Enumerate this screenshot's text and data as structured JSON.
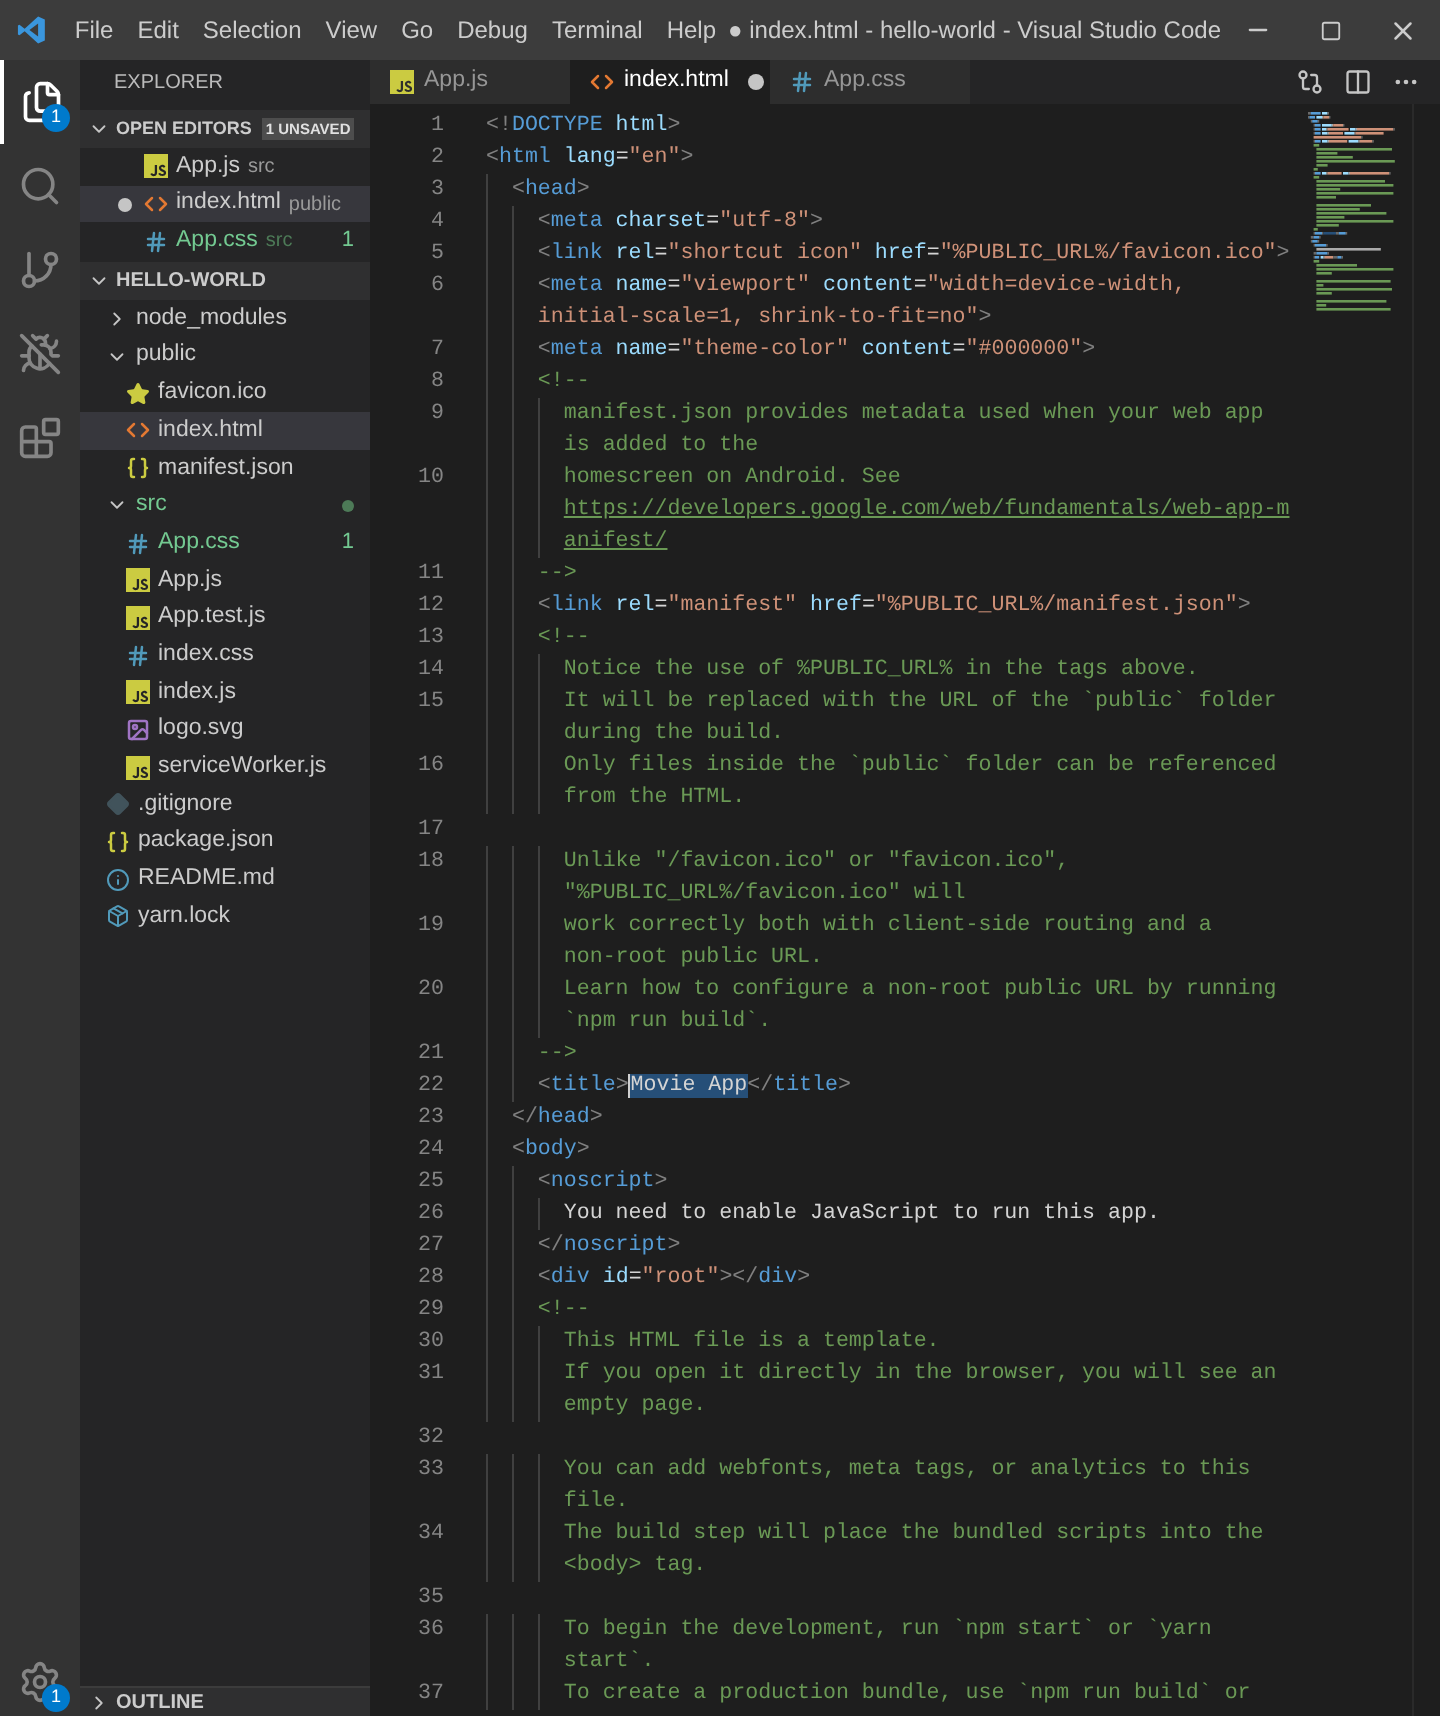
{
  "window": {
    "title": "● index.html - hello-world - Visual Studio Code",
    "menu": [
      "File",
      "Edit",
      "Selection",
      "View",
      "Go",
      "Debug",
      "Terminal",
      "Help"
    ]
  },
  "activity_bar": [
    {
      "kind": "files",
      "selected": true,
      "badge": "1"
    },
    {
      "kind": "search",
      "selected": false
    },
    {
      "kind": "source-control",
      "selected": false
    },
    {
      "kind": "debug",
      "selected": false
    },
    {
      "kind": "extensions",
      "selected": false
    }
  ],
  "settings_badge": "1",
  "sidebar": {
    "title": "EXPLORER",
    "open_editors": {
      "title": "OPEN EDITORS",
      "badge": "1 UNSAVED",
      "expanded": true,
      "items": [
        {
          "label": "App.js",
          "detail": "src",
          "kind": "js",
          "dirty": false,
          "selected": false,
          "modified": false
        },
        {
          "label": "index.html",
          "detail": "public",
          "kind": "html",
          "dirty": true,
          "selected": true,
          "modified": false
        },
        {
          "label": "App.css",
          "detail": "src",
          "kind": "css",
          "dirty": false,
          "selected": false,
          "modified": true,
          "badge": "1"
        }
      ]
    },
    "project": {
      "title": "HELLO-WORLD",
      "expanded": true,
      "items": [
        {
          "label": "node_modules",
          "kind": "folder",
          "expanded": false,
          "selected": false,
          "modified": false
        },
        {
          "label": "public",
          "kind": "folder",
          "expanded": true,
          "selected": false,
          "modified": false,
          "children": [
            {
              "label": "favicon.ico",
              "kind": "ico",
              "selected": false,
              "modified": false
            },
            {
              "label": "index.html",
              "kind": "html",
              "selected": true,
              "modified": false
            },
            {
              "label": "manifest.json",
              "kind": "json",
              "selected": false,
              "modified": false
            }
          ]
        },
        {
          "label": "src",
          "kind": "folder",
          "expanded": true,
          "selected": false,
          "modified": true,
          "children": [
            {
              "label": "App.css",
              "kind": "css",
              "selected": false,
              "modified": true,
              "badge": "1"
            },
            {
              "label": "App.js",
              "kind": "js",
              "selected": false,
              "modified": false
            },
            {
              "label": "App.test.js",
              "kind": "js",
              "selected": false,
              "modified": false
            },
            {
              "label": "index.css",
              "kind": "css",
              "selected": false,
              "modified": false
            },
            {
              "label": "index.js",
              "kind": "js",
              "selected": false,
              "modified": false
            },
            {
              "label": "logo.svg",
              "kind": "svg",
              "selected": false,
              "modified": false
            },
            {
              "label": "serviceWorker.js",
              "kind": "js",
              "selected": false,
              "modified": false
            }
          ]
        },
        {
          "label": ".gitignore",
          "kind": "git",
          "selected": false,
          "modified": false
        },
        {
          "label": "package.json",
          "kind": "json",
          "selected": false,
          "modified": false
        },
        {
          "label": "README.md",
          "kind": "md",
          "selected": false,
          "modified": false
        },
        {
          "label": "yarn.lock",
          "kind": "lock",
          "selected": false,
          "modified": false
        }
      ]
    },
    "outline": {
      "title": "OUTLINE",
      "expanded": false
    }
  },
  "tabs": [
    {
      "label": "App.js",
      "kind": "js",
      "selected": false,
      "dirty": false
    },
    {
      "label": "index.html",
      "kind": "html",
      "selected": true,
      "dirty": true
    },
    {
      "label": "App.css",
      "kind": "css",
      "selected": false,
      "dirty": false
    }
  ],
  "editor": {
    "lines": [
      {
        "number": "1",
        "rows": [
          {
            "tokens": [
              {
                "kind": "p",
                "text": "<!"
              },
              {
                "kind": "tag",
                "text": "DOCTYPE"
              },
              {
                "kind": "attr",
                "text": " html"
              },
              {
                "kind": "p",
                "text": ">"
              }
            ]
          }
        ]
      },
      {
        "number": "2",
        "rows": [
          {
            "tokens": [
              {
                "kind": "p",
                "text": "<"
              },
              {
                "kind": "tag",
                "text": "html"
              },
              {
                "kind": "attr",
                "text": " lang"
              },
              {
                "kind": "txt",
                "text": "="
              },
              {
                "kind": "str",
                "text": "\"en\""
              },
              {
                "kind": "p",
                "text": ">"
              }
            ]
          }
        ]
      },
      {
        "number": "3",
        "rows": [
          {
            "tokens": [
              {
                "kind": "p",
                "text": "  <"
              },
              {
                "kind": "tag",
                "text": "head"
              },
              {
                "kind": "p",
                "text": ">"
              }
            ]
          }
        ]
      },
      {
        "number": "4",
        "rows": [
          {
            "tokens": [
              {
                "kind": "p",
                "text": "    <"
              },
              {
                "kind": "tag",
                "text": "meta"
              },
              {
                "kind": "attr",
                "text": " charset"
              },
              {
                "kind": "txt",
                "text": "="
              },
              {
                "kind": "str",
                "text": "\"utf-8\""
              },
              {
                "kind": "p",
                "text": ">"
              }
            ]
          }
        ]
      },
      {
        "number": "5",
        "rows": [
          {
            "tokens": [
              {
                "kind": "p",
                "text": "    <"
              },
              {
                "kind": "tag",
                "text": "link"
              },
              {
                "kind": "attr",
                "text": " rel"
              },
              {
                "kind": "txt",
                "text": "="
              },
              {
                "kind": "str",
                "text": "\"shortcut icon\""
              },
              {
                "kind": "attr",
                "text": " href"
              },
              {
                "kind": "txt",
                "text": "="
              },
              {
                "kind": "str",
                "text": "\"%PUBLIC_URL%/favicon.ico\""
              },
              {
                "kind": "p",
                "text": ">"
              }
            ]
          }
        ]
      },
      {
        "number": "6",
        "rows": [
          {
            "tokens": [
              {
                "kind": "p",
                "text": "    <"
              },
              {
                "kind": "tag",
                "text": "meta"
              },
              {
                "kind": "attr",
                "text": " name"
              },
              {
                "kind": "txt",
                "text": "="
              },
              {
                "kind": "str",
                "text": "\"viewport\""
              },
              {
                "kind": "attr",
                "text": " content"
              },
              {
                "kind": "txt",
                "text": "="
              },
              {
                "kind": "str",
                "text": "\"width=device-width,"
              }
            ]
          },
          {
            "tokens": [
              {
                "kind": "str",
                "text": "    initial-scale=1, shrink-to-fit=no\""
              },
              {
                "kind": "p",
                "text": ">"
              }
            ]
          }
        ]
      },
      {
        "number": "7",
        "rows": [
          {
            "tokens": [
              {
                "kind": "p",
                "text": "    <"
              },
              {
                "kind": "tag",
                "text": "meta"
              },
              {
                "kind": "attr",
                "text": " name"
              },
              {
                "kind": "txt",
                "text": "="
              },
              {
                "kind": "str",
                "text": "\"theme-color\""
              },
              {
                "kind": "attr",
                "text": " content"
              },
              {
                "kind": "txt",
                "text": "="
              },
              {
                "kind": "str",
                "text": "\"#000000\""
              },
              {
                "kind": "p",
                "text": ">"
              }
            ]
          }
        ]
      },
      {
        "number": "8",
        "rows": [
          {
            "tokens": [
              {
                "kind": "cmt",
                "text": "    <!--"
              }
            ]
          }
        ]
      },
      {
        "number": "9",
        "rows": [
          {
            "tokens": [
              {
                "kind": "cmt",
                "text": "      manifest.json provides metadata used when your web app"
              }
            ]
          },
          {
            "tokens": [
              {
                "kind": "cmt",
                "text": "      is added to the"
              }
            ]
          }
        ]
      },
      {
        "number": "10",
        "rows": [
          {
            "tokens": [
              {
                "kind": "cmt",
                "text": "      homescreen on Android. See"
              }
            ]
          },
          {
            "tokens": [
              {
                "kind": "link",
                "text": "      https://developers.google.com/web/fundamentals/web-app-m"
              }
            ]
          },
          {
            "tokens": [
              {
                "kind": "link",
                "text": "      anifest/"
              }
            ]
          }
        ]
      },
      {
        "number": "11",
        "rows": [
          {
            "tokens": [
              {
                "kind": "cmt",
                "text": "    -->"
              }
            ]
          }
        ]
      },
      {
        "number": "12",
        "rows": [
          {
            "tokens": [
              {
                "kind": "p",
                "text": "    <"
              },
              {
                "kind": "tag",
                "text": "link"
              },
              {
                "kind": "attr",
                "text": " rel"
              },
              {
                "kind": "txt",
                "text": "="
              },
              {
                "kind": "str",
                "text": "\"manifest\""
              },
              {
                "kind": "attr",
                "text": " href"
              },
              {
                "kind": "txt",
                "text": "="
              },
              {
                "kind": "str",
                "text": "\"%PUBLIC_URL%/manifest.json\""
              },
              {
                "kind": "p",
                "text": ">"
              }
            ]
          }
        ]
      },
      {
        "number": "13",
        "rows": [
          {
            "tokens": [
              {
                "kind": "cmt",
                "text": "    <!--"
              }
            ]
          }
        ]
      },
      {
        "number": "14",
        "rows": [
          {
            "tokens": [
              {
                "kind": "cmt",
                "text": "      Notice the use of %PUBLIC_URL% in the tags above."
              }
            ]
          }
        ]
      },
      {
        "number": "15",
        "rows": [
          {
            "tokens": [
              {
                "kind": "cmt",
                "text": "      It will be replaced with the URL of the `public` folder"
              }
            ]
          },
          {
            "tokens": [
              {
                "kind": "cmt",
                "text": "      during the build."
              }
            ]
          }
        ]
      },
      {
        "number": "16",
        "rows": [
          {
            "tokens": [
              {
                "kind": "cmt",
                "text": "      Only files inside the `public` folder can be referenced"
              }
            ]
          },
          {
            "tokens": [
              {
                "kind": "cmt",
                "text": "      from the HTML."
              }
            ]
          }
        ]
      },
      {
        "number": "17"
      },
      {
        "number": "18",
        "rows": [
          {
            "tokens": [
              {
                "kind": "cmt",
                "text": "      Unlike \"/favicon.ico\" or \"favicon.ico\","
              }
            ]
          },
          {
            "tokens": [
              {
                "kind": "cmt",
                "text": "      \"%PUBLIC_URL%/favicon.ico\" will"
              }
            ]
          }
        ]
      },
      {
        "number": "19",
        "rows": [
          {
            "tokens": [
              {
                "kind": "cmt",
                "text": "      work correctly both with client-side routing and a"
              }
            ]
          },
          {
            "tokens": [
              {
                "kind": "cmt",
                "text": "      non-root public URL."
              }
            ]
          }
        ]
      },
      {
        "number": "20",
        "rows": [
          {
            "tokens": [
              {
                "kind": "cmt",
                "text": "      Learn how to configure a non-root public URL by running"
              }
            ]
          },
          {
            "tokens": [
              {
                "kind": "cmt",
                "text": "      `npm run build`."
              }
            ]
          }
        ]
      },
      {
        "number": "21",
        "rows": [
          {
            "tokens": [
              {
                "kind": "cmt",
                "text": "    -->"
              }
            ]
          }
        ]
      },
      {
        "number": "22",
        "rows": [
          {
            "tokens": [
              {
                "kind": "p",
                "text": "    <"
              },
              {
                "kind": "tag",
                "text": "title"
              },
              {
                "kind": "p",
                "text": ">"
              },
              {
                "kind": "sel",
                "text": "Movie App"
              },
              {
                "kind": "p",
                "text": "</"
              },
              {
                "kind": "tag",
                "text": "title"
              },
              {
                "kind": "p",
                "text": ">"
              }
            ]
          }
        ]
      },
      {
        "number": "23",
        "rows": [
          {
            "tokens": [
              {
                "kind": "p",
                "text": "  </"
              },
              {
                "kind": "tag",
                "text": "head"
              },
              {
                "kind": "p",
                "text": ">"
              }
            ]
          }
        ]
      },
      {
        "number": "24",
        "rows": [
          {
            "tokens": [
              {
                "kind": "p",
                "text": "  <"
              },
              {
                "kind": "tag",
                "text": "body"
              },
              {
                "kind": "p",
                "text": ">"
              }
            ]
          }
        ]
      },
      {
        "number": "25",
        "rows": [
          {
            "tokens": [
              {
                "kind": "p",
                "text": "    <"
              },
              {
                "kind": "tag",
                "text": "noscript"
              },
              {
                "kind": "p",
                "text": ">"
              }
            ]
          }
        ]
      },
      {
        "number": "26",
        "rows": [
          {
            "tokens": [
              {
                "kind": "txt",
                "text": "      You need to enable JavaScript to run this app."
              }
            ]
          }
        ]
      },
      {
        "number": "27",
        "rows": [
          {
            "tokens": [
              {
                "kind": "p",
                "text": "    </"
              },
              {
                "kind": "tag",
                "text": "noscript"
              },
              {
                "kind": "p",
                "text": ">"
              }
            ]
          }
        ]
      },
      {
        "number": "28",
        "rows": [
          {
            "tokens": [
              {
                "kind": "p",
                "text": "    <"
              },
              {
                "kind": "tag",
                "text": "div"
              },
              {
                "kind": "attr",
                "text": " id"
              },
              {
                "kind": "txt",
                "text": "="
              },
              {
                "kind": "str",
                "text": "\"root\""
              },
              {
                "kind": "p",
                "text": "></"
              },
              {
                "kind": "tag",
                "text": "div"
              },
              {
                "kind": "p",
                "text": ">"
              }
            ]
          }
        ]
      },
      {
        "number": "29",
        "rows": [
          {
            "tokens": [
              {
                "kind": "cmt",
                "text": "    <!--"
              }
            ]
          }
        ]
      },
      {
        "number": "30",
        "rows": [
          {
            "tokens": [
              {
                "kind": "cmt",
                "text": "      This HTML file is a template."
              }
            ]
          }
        ]
      },
      {
        "number": "31",
        "rows": [
          {
            "tokens": [
              {
                "kind": "cmt",
                "text": "      If you open it directly in the browser, you will see an"
              }
            ]
          },
          {
            "tokens": [
              {
                "kind": "cmt",
                "text": "      empty page."
              }
            ]
          }
        ]
      },
      {
        "number": "32"
      },
      {
        "number": "33",
        "rows": [
          {
            "tokens": [
              {
                "kind": "cmt",
                "text": "      You can add webfonts, meta tags, or analytics to this"
              }
            ]
          },
          {
            "tokens": [
              {
                "kind": "cmt",
                "text": "      file."
              }
            ]
          }
        ]
      },
      {
        "number": "34",
        "rows": [
          {
            "tokens": [
              {
                "kind": "cmt",
                "text": "      The build step will place the bundled scripts into the"
              }
            ]
          },
          {
            "tokens": [
              {
                "kind": "cmt",
                "text": "      <body> tag."
              }
            ]
          }
        ]
      },
      {
        "number": "35"
      },
      {
        "number": "36",
        "rows": [
          {
            "tokens": [
              {
                "kind": "cmt",
                "text": "      To begin the development, run `npm start` or `yarn"
              }
            ]
          },
          {
            "tokens": [
              {
                "kind": "cmt",
                "text": "      start`."
              }
            ]
          }
        ]
      },
      {
        "number": "37",
        "rows": [
          {
            "tokens": [
              {
                "kind": "cmt",
                "text": "      To create a production bundle, use `npm run build` or"
              }
            ]
          }
        ]
      }
    ]
  }
}
